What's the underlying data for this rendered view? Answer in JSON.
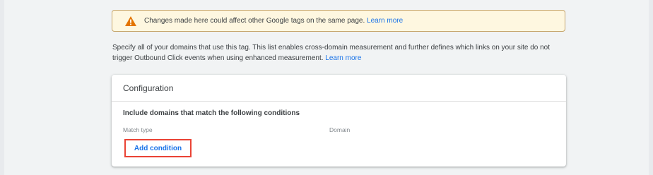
{
  "warning": {
    "icon": "warning-icon",
    "text": "Changes made here could affect other Google tags on the same page.",
    "link": "Learn more"
  },
  "description": {
    "text": "Specify all of your domains that use this tag. This list enables cross-domain measurement and further defines which links on your site do not trigger Outbound Click events when using enhanced measurement.",
    "link": "Learn more"
  },
  "configuration": {
    "title": "Configuration",
    "rule_title": "Include domains that match the following conditions",
    "columns": [
      "Match type",
      "Domain"
    ],
    "add_button": "Add condition"
  },
  "colors": {
    "accent": "#1a73e8",
    "warning_icon": "#e37400",
    "highlight": "#ea4335"
  }
}
